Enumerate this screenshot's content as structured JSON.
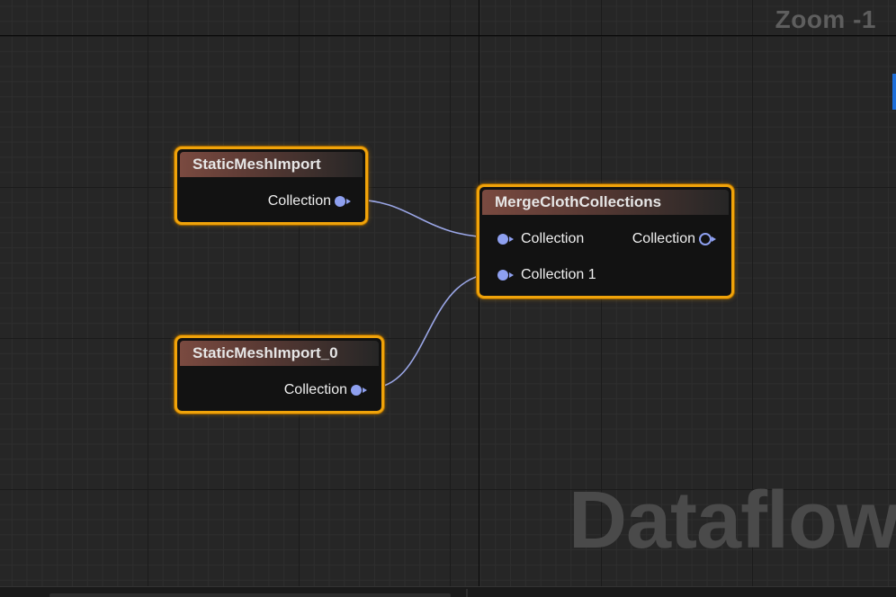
{
  "graph": {
    "zoom_label": "Zoom -1",
    "watermark": "Dataflow"
  },
  "nodes": [
    {
      "title": "StaticMeshImport",
      "outputs": [
        "Collection"
      ]
    },
    {
      "title": "StaticMeshImport_0",
      "outputs": [
        "Collection"
      ]
    },
    {
      "title": "MergeClothCollections",
      "inputs": [
        "Collection",
        "Collection 1"
      ],
      "outputs": [
        "Collection"
      ]
    }
  ],
  "colors": {
    "node_border": "#f0a30a",
    "pin": "#8ea0f0",
    "wire": "#9aa6e6",
    "canvas": "#262626"
  }
}
